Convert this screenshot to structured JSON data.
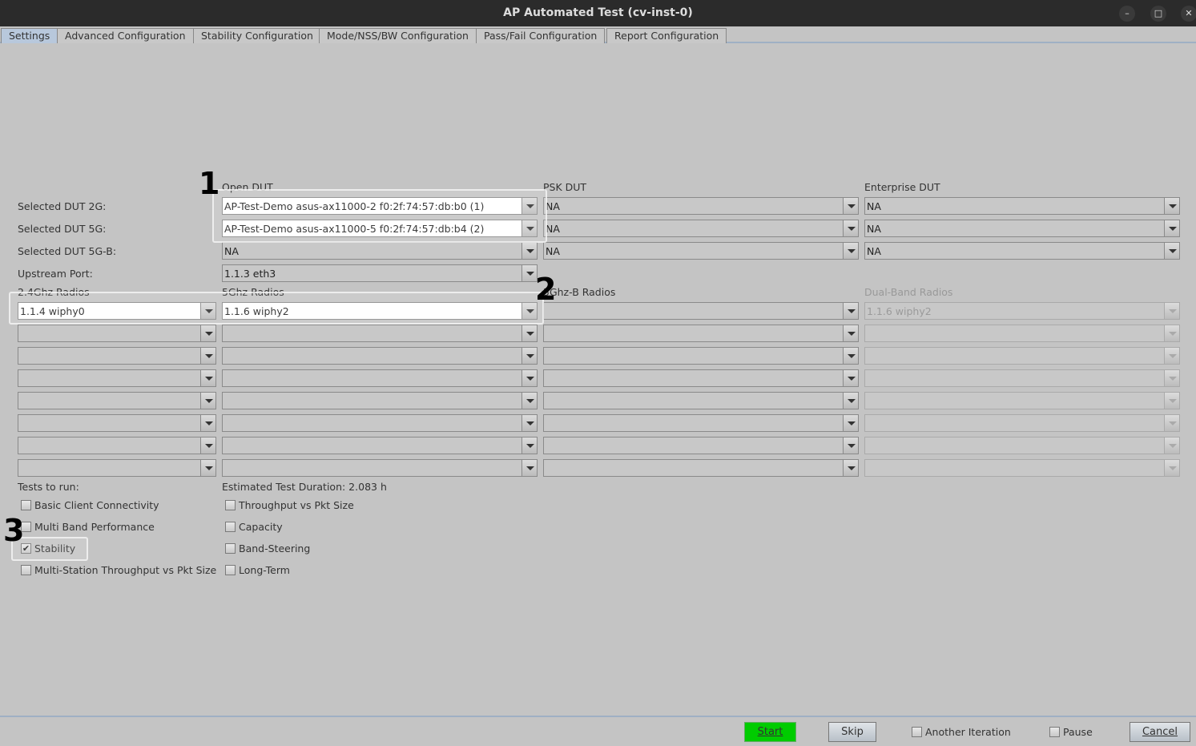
{
  "window": {
    "title": "AP Automated Test  (cv-inst-0)",
    "minimize": "–",
    "maximize": "□",
    "close": "✕"
  },
  "tabs": [
    "Settings",
    "Advanced Configuration",
    "Stability Configuration",
    "Mode/NSS/BW Configuration",
    "Pass/Fail Configuration",
    "Report Configuration"
  ],
  "dut": {
    "headers": [
      "Open DUT",
      "PSK DUT",
      "Enterprise DUT"
    ],
    "rows": [
      {
        "label": "Selected DUT 2G:",
        "values": [
          "AP-Test-Demo asus-ax11000-2 f0:2f:74:57:db:b0 (1)",
          "NA",
          "NA"
        ]
      },
      {
        "label": "Selected DUT 5G:",
        "values": [
          "AP-Test-Demo asus-ax11000-5 f0:2f:74:57:db:b4 (2)",
          "NA",
          "NA"
        ]
      },
      {
        "label": "Selected DUT 5G-B:",
        "values": [
          "NA",
          "NA",
          "NA"
        ]
      }
    ],
    "upstream_label": "Upstream Port:",
    "upstream_value": "1.1.3 eth3"
  },
  "radios": {
    "headers": [
      "2.4Ghz Radios",
      "5Ghz Radios",
      "5Ghz-B Radios",
      "Dual-Band Radios"
    ],
    "first_row": [
      "1.1.4 wiphy0",
      "1.1.6 wiphy2",
      "",
      "1.1.6 wiphy2"
    ]
  },
  "tests": {
    "label": "Tests to run:",
    "duration": "Estimated Test Duration: 2.083 h",
    "left": [
      {
        "label": "Basic Client Connectivity",
        "checked": false
      },
      {
        "label": "Multi Band Performance",
        "checked": false
      },
      {
        "label": "Stability",
        "checked": true
      },
      {
        "label": "Multi-Station Throughput vs Pkt Size",
        "checked": false
      }
    ],
    "right": [
      {
        "label": "Throughput vs Pkt Size",
        "checked": false
      },
      {
        "label": "Capacity",
        "checked": false
      },
      {
        "label": "Band-Steering",
        "checked": false
      },
      {
        "label": "Long-Term",
        "checked": false
      }
    ]
  },
  "annotations": [
    "1",
    "2",
    "3"
  ],
  "footer": {
    "start": "Start",
    "skip": "Skip",
    "another_iteration": "Another Iteration",
    "pause": "Pause",
    "cancel": "Cancel",
    "start_color": "#00cc00"
  }
}
